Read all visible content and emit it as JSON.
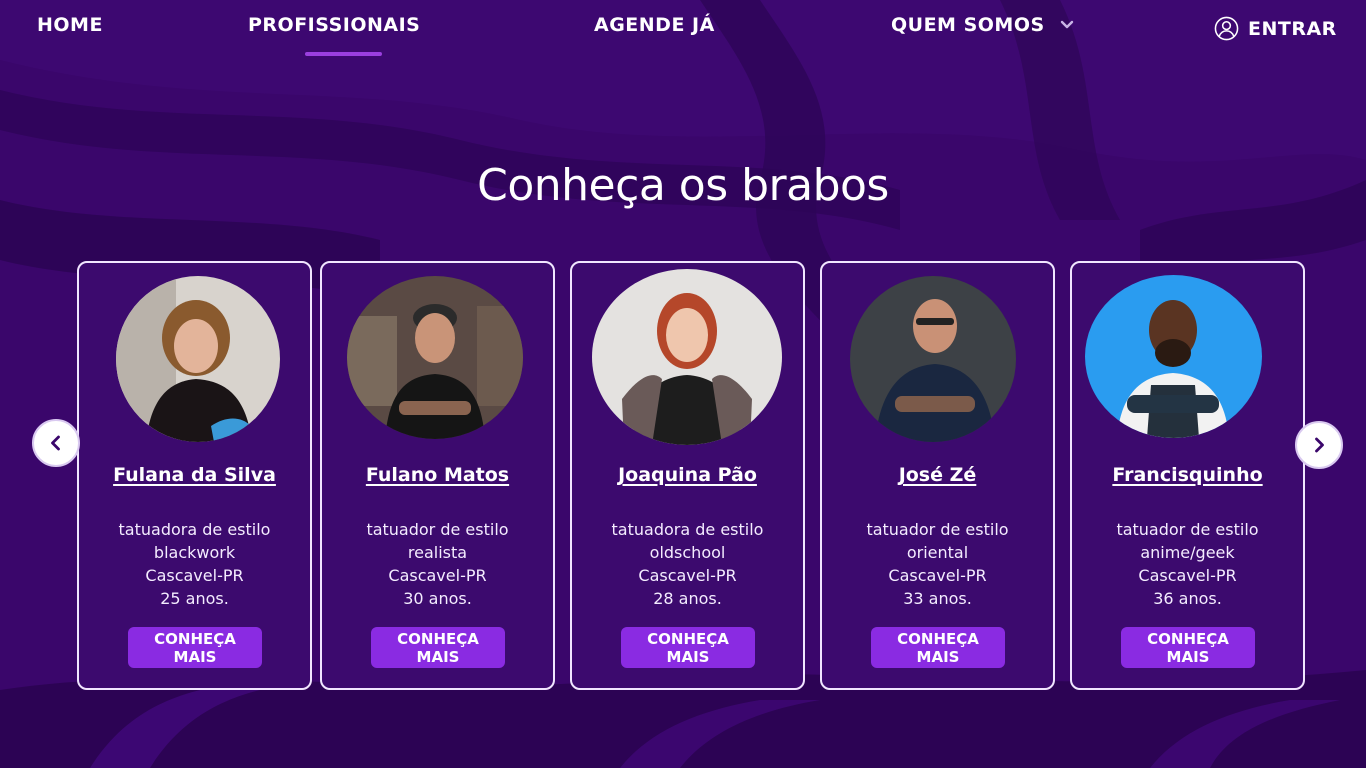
{
  "nav": {
    "home": "HOME",
    "profissionais": "PROFISSIONAIS",
    "agende": "AGENDE JÁ",
    "quem_somos": "QUEM SOMOS",
    "entrar": "ENTRAR",
    "active": "PROFISSIONAIS"
  },
  "title": "Conheça os brabos",
  "cards": [
    {
      "name": "Fulana da Silva",
      "role": "tatuadora de estilo",
      "style": "blackwork",
      "city": "Cascavel-PR",
      "age": "25 anos.",
      "button": [
        "CONHEÇA",
        "MAIS"
      ]
    },
    {
      "name": "Fulano Matos",
      "role": "tatuador de estilo",
      "style": "realista",
      "city": "Cascavel-PR",
      "age": "30 anos.",
      "button": [
        "CONHEÇA",
        "MAIS"
      ]
    },
    {
      "name": "Joaquina Pão",
      "role": "tatuadora de estilo",
      "style": "oldschool",
      "city": "Cascavel-PR",
      "age": "28 anos.",
      "button": [
        "CONHEÇA",
        "MAIS"
      ]
    },
    {
      "name": "José Zé",
      "role": "tatuador de estilo",
      "style": "oriental",
      "city": "Cascavel-PR",
      "age": "33 anos.",
      "button": [
        "CONHEÇA",
        "MAIS"
      ]
    },
    {
      "name": "Francisquinho",
      "role": "tatuador de estilo",
      "style": "anime/geek",
      "city": "Cascavel-PR",
      "age": "36 anos.",
      "button": [
        "CONHEÇA",
        "MAIS"
      ]
    }
  ],
  "icons": {
    "dropdown": "chevron-down-icon",
    "login": "user-circle-icon",
    "prev": "chevron-left-icon",
    "next": "chevron-right-icon"
  },
  "colors": {
    "background": "#3a066b",
    "wave_dark": "#2a0350",
    "accent": "#8a2be2",
    "active_bar": "#9b3fe0",
    "card_border": "#f1e6ff"
  }
}
